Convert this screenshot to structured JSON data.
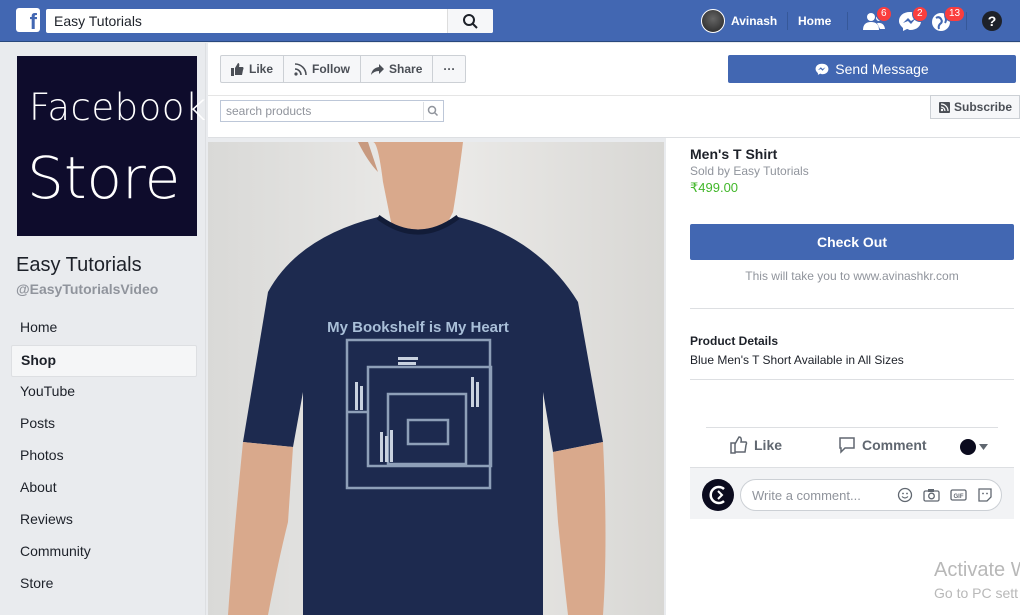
{
  "topbar": {
    "logo": "f",
    "search_value": "Easy Tutorials",
    "user_name": "Avinash",
    "home_label": "Home",
    "friend_requests_badge": "6",
    "messages_badge": "2",
    "notifications_badge": "13",
    "help_label": "?"
  },
  "sidebar": {
    "cover_line1": "Facebook",
    "cover_line2": "Store",
    "page_name": "Easy Tutorials",
    "page_handle": "@EasyTutorialsVideo",
    "items": [
      {
        "label": "Home"
      },
      {
        "label": "Shop"
      },
      {
        "label": "YouTube"
      },
      {
        "label": "Posts"
      },
      {
        "label": "Photos"
      },
      {
        "label": "About"
      },
      {
        "label": "Reviews"
      },
      {
        "label": "Community"
      },
      {
        "label": "Store"
      }
    ]
  },
  "actionbar": {
    "like_label": "Like",
    "follow_label": "Follow",
    "share_label": "Share",
    "more_label": "···",
    "send_message_label": "Send Message",
    "search_placeholder": "search products",
    "subscribe_label": "Subscribe"
  },
  "product": {
    "image_text": "My Bookshelf is My Heart",
    "title": "Men's T Shirt",
    "sold_by": "Sold by Easy Tutorials",
    "price": "₹499.00",
    "checkout_label": "Check Out",
    "checkout_note": "This will take you to www.avinashkr.com",
    "details_title": "Product Details",
    "details_text": "Blue Men's T Short Available in All Sizes"
  },
  "reactions": {
    "like_label": "Like",
    "comment_label": "Comment",
    "comment_placeholder": "Write a comment..."
  },
  "watermark": {
    "line1": "Activate W",
    "line2": "Go to PC sett"
  },
  "colors": {
    "brand_blue": "#4267b2",
    "price_green": "#42b72a",
    "badge_red": "#fa3e3e"
  }
}
